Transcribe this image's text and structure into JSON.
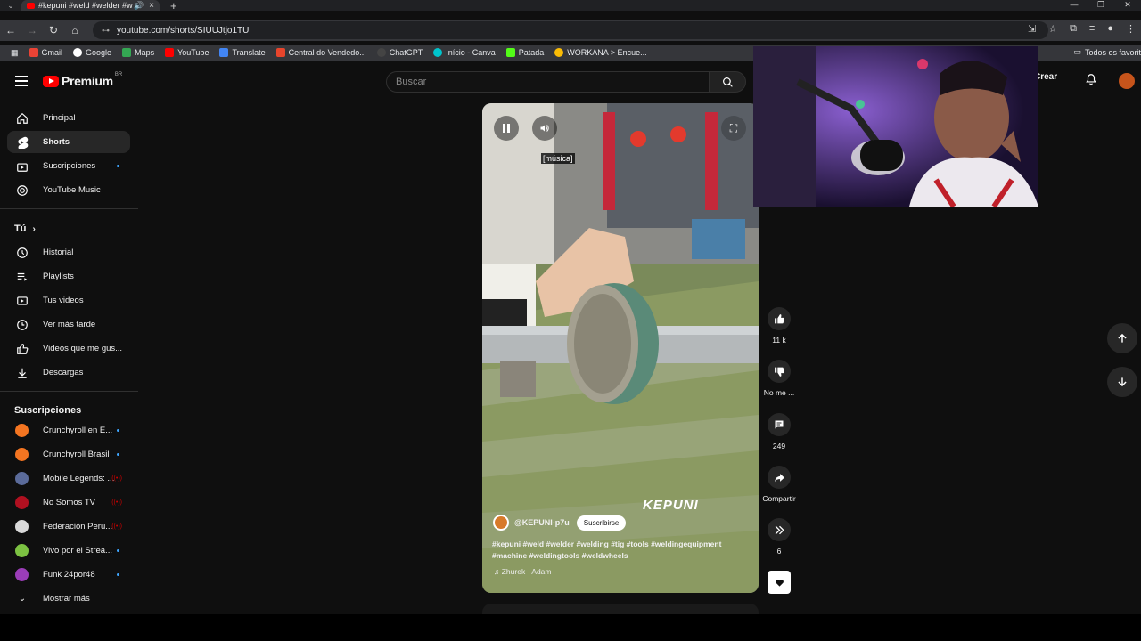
{
  "browser": {
    "tab_title": "#kepuni #weld #welder #w",
    "url": "youtube.com/shorts/SIUUJtjo1TU",
    "bookmarks": [
      "Gmail",
      "Google",
      "Maps",
      "YouTube",
      "Translate",
      "Central do Vendedo...",
      "ChatGPT",
      "Início - Canva",
      "Patada",
      "WORKANA > Encue..."
    ],
    "bookmarks_right": "Todos os favorit"
  },
  "header": {
    "logo_text": "Premium",
    "country_code": "BR",
    "search_placeholder": "Buscar",
    "create_label": "Crear"
  },
  "sidebar": {
    "main": [
      {
        "label": "Principal",
        "icon": "home-icon"
      },
      {
        "label": "Shorts",
        "icon": "shorts-icon"
      },
      {
        "label": "Suscripciones",
        "icon": "subscriptions-icon"
      },
      {
        "label": "YouTube Music",
        "icon": "music-icon"
      }
    ],
    "you_heading": "Tú",
    "you": [
      {
        "label": "Historial",
        "icon": "history-icon"
      },
      {
        "label": "Playlists",
        "icon": "playlists-icon"
      },
      {
        "label": "Tus videos",
        "icon": "your-videos-icon"
      },
      {
        "label": "Ver más tarde",
        "icon": "watch-later-icon"
      },
      {
        "label": "Videos que me gus...",
        "icon": "liked-icon"
      },
      {
        "label": "Descargas",
        "icon": "download-icon"
      }
    ],
    "subs_heading": "Suscripciones",
    "subs": [
      {
        "label": "Crunchyroll en E...",
        "color": "#f47521",
        "status": "dot"
      },
      {
        "label": "Crunchyroll Brasil",
        "color": "#f47521",
        "status": "dot"
      },
      {
        "label": "Mobile Legends: ...",
        "color": "#5b6b9a",
        "status": "live"
      },
      {
        "label": "No Somos TV",
        "color": "#b01020",
        "status": "live"
      },
      {
        "label": "Federación Peru...",
        "color": "#d9d9d9",
        "status": "live"
      },
      {
        "label": "Vivo por el Strea...",
        "color": "#7cc242",
        "status": "dot"
      },
      {
        "label": "Funk 24por48",
        "color": "#9b3db8",
        "status": "dot"
      }
    ],
    "show_more": "Mostrar más"
  },
  "short": {
    "caption": "[música]",
    "brand_overlay": "KEPUNI",
    "channel": "@KEPUNI-p7u",
    "subscribe_label": "Suscribirse",
    "description": "#kepuni #weld #welder #welding #tig #tools #weldingequipment #machine #weldingtools #weldwheels",
    "song": "♫ Zhurek · Adam"
  },
  "actions": {
    "likes": "11 k",
    "dislike_label": "No me ...",
    "comments": "249",
    "share_label": "Compartir",
    "remix_count": "6"
  }
}
